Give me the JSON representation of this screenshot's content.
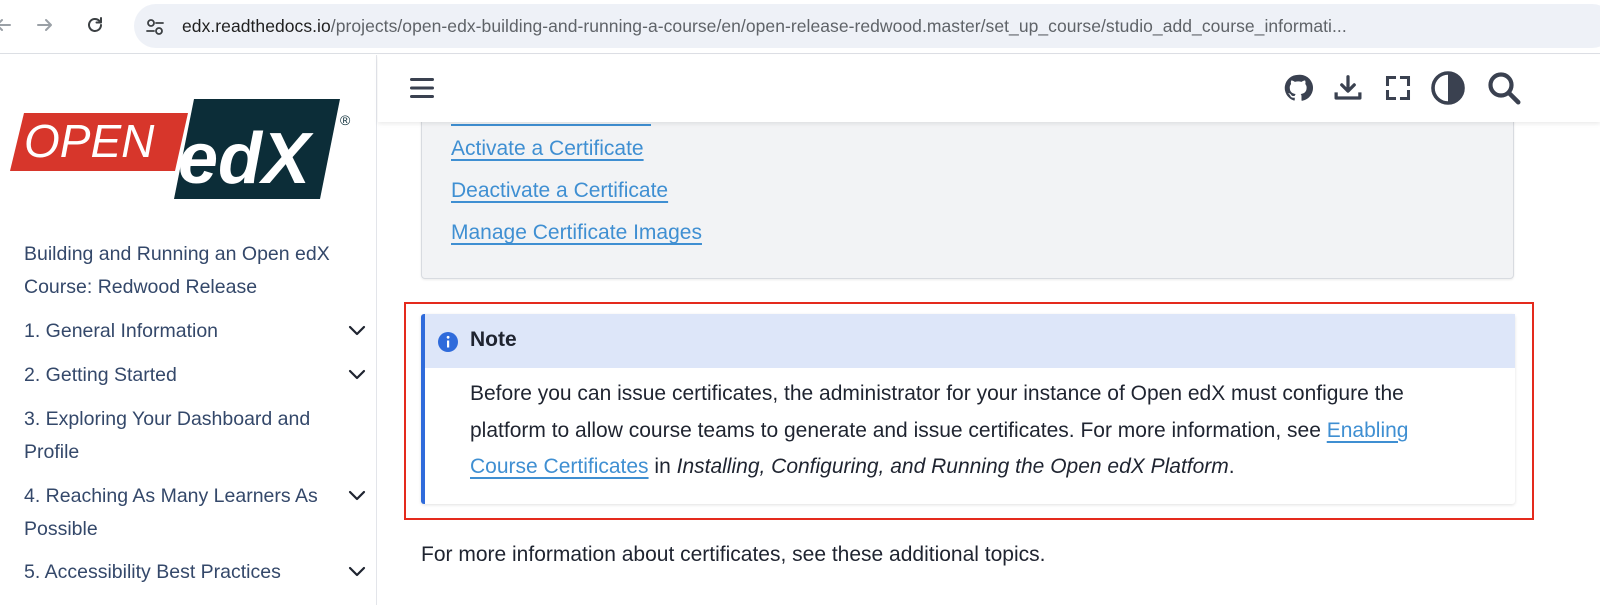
{
  "browser": {
    "url_host": "edx.readthedocs.io",
    "url_path": "/projects/open-edx-building-and-running-a-course/en/open-release-redwood.master/set_up_course/studio_add_course_informati..."
  },
  "logo": {
    "text_open": "OPEN",
    "text_edx": "edX",
    "registered": "®"
  },
  "sidebar": {
    "title": "Building and Running an Open edX Course: Redwood Release",
    "items": [
      {
        "label": "1. General Information",
        "expandable": true
      },
      {
        "label": "2. Getting Started",
        "expandable": true
      },
      {
        "label": "3. Exploring Your Dashboard and Profile",
        "expandable": false
      },
      {
        "label": "4. Reaching As Many Learners As Possible",
        "expandable": true
      },
      {
        "label": "5. Accessibility Best Practices",
        "expandable": true
      }
    ]
  },
  "header": {
    "icons": [
      "menu-icon",
      "github-icon",
      "download-icon",
      "fullscreen-icon",
      "theme-toggle-icon",
      "search-icon"
    ]
  },
  "toc": {
    "links": [
      "Activate a Certificate",
      "Deactivate a Certificate",
      "Manage Certificate Images"
    ]
  },
  "note": {
    "title": "Note",
    "body_part1": "Before you can issue certificates, the administrator for your instance of Open edX must configure the platform to allow course teams to generate and issue certificates. For more information, see",
    "link_text": "Enabling Course Certificates",
    "body_part2": "in",
    "book_title": "Installing, Configuring, and Running the Open edX Platform",
    "body_end": "."
  },
  "paragraph": "For more information about certificates, see these additional topics.",
  "colors": {
    "link": "#3f8fd2",
    "note_accent": "#2f6bdb",
    "note_header_bg": "#dde6f9",
    "highlight_border": "#e42a1d",
    "logo_red": "#d7362b",
    "logo_dark": "#0c2d38"
  }
}
